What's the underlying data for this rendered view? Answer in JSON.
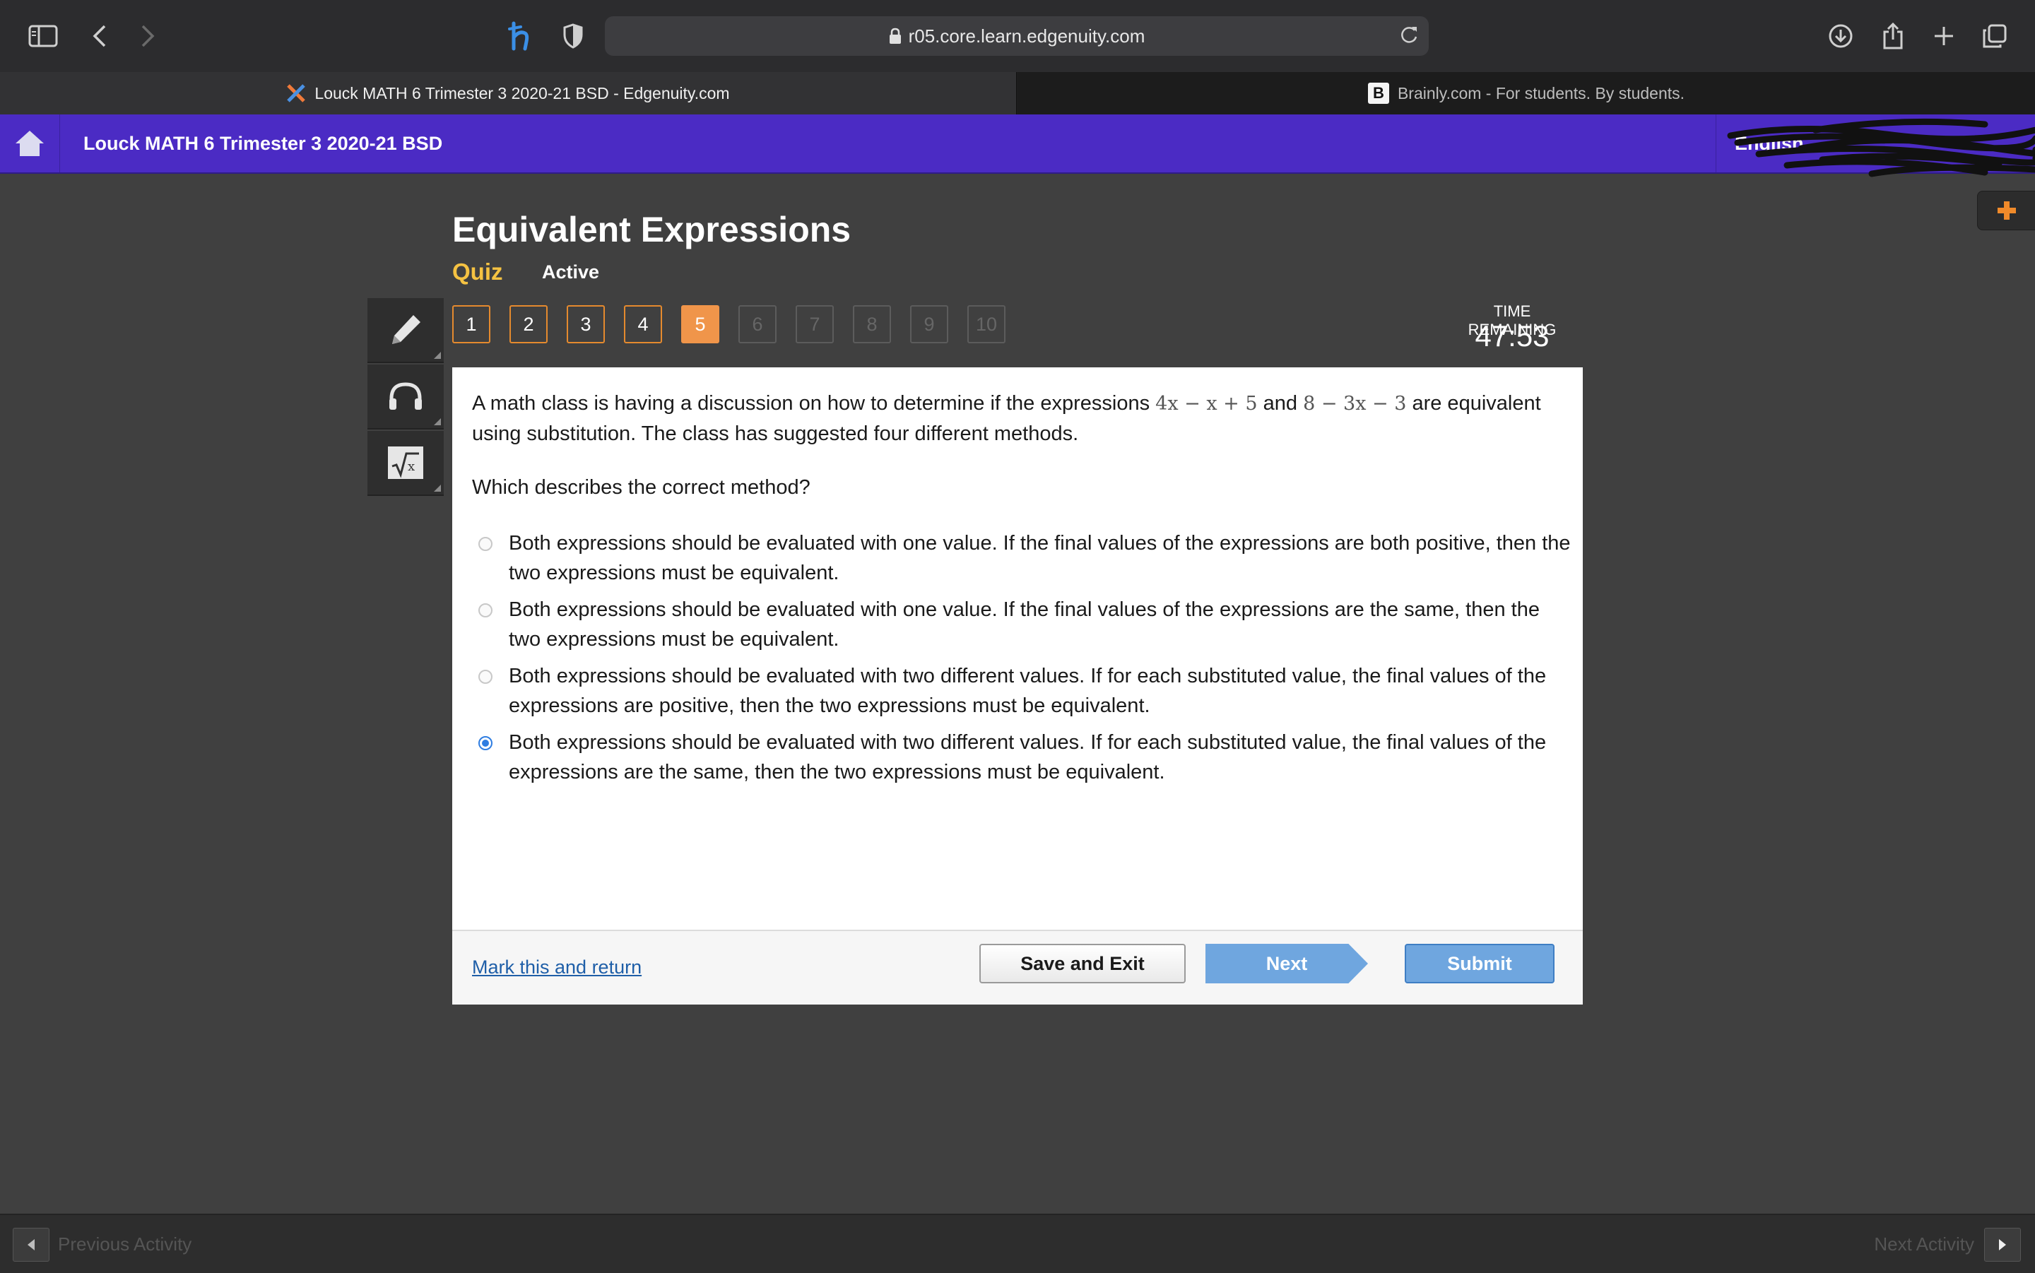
{
  "browser": {
    "url": "r05.core.learn.edgenuity.com",
    "tabs": [
      {
        "title": "Louck MATH 6 Trimester 3 2020-21 BSD - Edgenuity.com",
        "active": true
      },
      {
        "title": "Brainly.com - For students. By students.",
        "active": false
      }
    ],
    "brainly_favicon_letter": "B"
  },
  "site": {
    "course_title": "Louck MATH 6 Trimester 3 2020-21 BSD",
    "language": "English",
    "header_color": "#4b2bc4"
  },
  "activity": {
    "title": "Equivalent Expressions",
    "type": "Quiz",
    "status": "Active",
    "questions": [
      "1",
      "2",
      "3",
      "4",
      "5",
      "6",
      "7",
      "8",
      "9",
      "10"
    ],
    "current_question": "5",
    "time_label": "TIME REMAINING",
    "time_value": "47:53"
  },
  "question": {
    "stem_before": "A math class is having a discussion on how to determine if the expressions ",
    "expr1": "4x − x + 5",
    "stem_middle": " and ",
    "expr2": "8 − 3x − 3",
    "stem_after": " are equivalent using substitution. The class has suggested four different methods.",
    "prompt": "Which describes the correct method?",
    "options": [
      "Both expressions should be evaluated with one value. If the final values of the expressions are both positive, then the two expressions must be equivalent.",
      "Both expressions should be evaluated with one value. If the final values of the expressions are the same, then the two expressions must be equivalent.",
      "Both expressions should be evaluated with two different values. If for each substituted value, the final values of the expressions are positive, then the two expressions must be equivalent.",
      "Both expressions should be evaluated with two different values. If for each substituted value, the final values of the expressions are the same, then the two expressions must be equivalent."
    ],
    "selected_option": 4
  },
  "footer": {
    "mark_link": "Mark this and return",
    "save_exit": "Save and Exit",
    "next": "Next",
    "submit": "Submit"
  },
  "bottom_nav": {
    "previous": "Previous Activity",
    "next": "Next Activity"
  },
  "colors": {
    "accent_orange": "#f0954a",
    "quiz_label": "#f5c242",
    "button_blue": "#6fa6df",
    "selected_radio": "#2f7de1"
  }
}
